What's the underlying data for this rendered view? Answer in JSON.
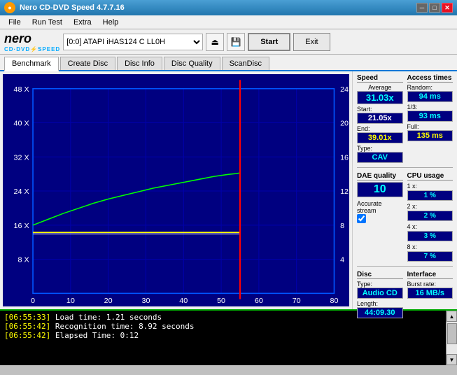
{
  "window": {
    "title": "Nero CD-DVD Speed 4.7.7.16",
    "icon": "cd"
  },
  "titlebar": {
    "min_label": "─",
    "max_label": "□",
    "close_label": "✕"
  },
  "menu": {
    "items": [
      "File",
      "Run Test",
      "Extra",
      "Help"
    ]
  },
  "toolbar": {
    "drive_value": "[0:0]  ATAPI iHAS124  C LL0H",
    "start_label": "Start",
    "exit_label": "Exit"
  },
  "tabs": [
    {
      "label": "Benchmark",
      "active": true
    },
    {
      "label": "Create Disc",
      "active": false
    },
    {
      "label": "Disc Info",
      "active": false
    },
    {
      "label": "Disc Quality",
      "active": false
    },
    {
      "label": "ScanDisc",
      "active": false
    }
  ],
  "stats": {
    "speed": {
      "label": "Speed",
      "average_label": "Average",
      "average_value": "31.03x",
      "start_label": "Start:",
      "start_value": "21.05x",
      "end_label": "End:",
      "end_value": "39.01x",
      "type_label": "Type:",
      "type_value": "CAV"
    },
    "access_times": {
      "label": "Access times",
      "random_label": "Random:",
      "random_value": "94 ms",
      "onethird_label": "1/3:",
      "onethird_value": "93 ms",
      "full_label": "Full:",
      "full_value": "135 ms"
    },
    "dae": {
      "label": "DAE quality",
      "value": "10"
    },
    "accurate_stream": {
      "label": "Accurate stream"
    },
    "cpu_usage": {
      "label": "CPU usage",
      "rows": [
        {
          "label": "1 x:",
          "value": "1 %"
        },
        {
          "label": "2 x:",
          "value": "2 %"
        },
        {
          "label": "4 x:",
          "value": "3 %"
        },
        {
          "label": "8 x:",
          "value": "7 %"
        }
      ]
    },
    "disc": {
      "label": "Disc",
      "type_label": "Type:",
      "type_value": "Audio CD",
      "length_label": "Length:",
      "length_value": "44:09.30"
    },
    "interface": {
      "label": "Interface",
      "burst_label": "Burst rate:",
      "burst_value": "16 MB/s"
    }
  },
  "log": {
    "lines": [
      {
        "timestamp": "[06:55:33]",
        "message": " Load time: 1.21 seconds"
      },
      {
        "timestamp": "[06:55:42]",
        "message": " Recognition time: 8.92 seconds"
      },
      {
        "timestamp": "[06:55:42]",
        "message": " Elapsed Time: 0:12"
      }
    ]
  },
  "chart": {
    "y_left": [
      "48 X",
      "40 X",
      "32 X",
      "24 X",
      "16 X",
      "8 X"
    ],
    "y_right": [
      "24",
      "20",
      "16",
      "12",
      "8",
      "4"
    ],
    "x_axis": [
      "0",
      "10",
      "20",
      "30",
      "40",
      "50",
      "60",
      "70",
      "80"
    ]
  }
}
